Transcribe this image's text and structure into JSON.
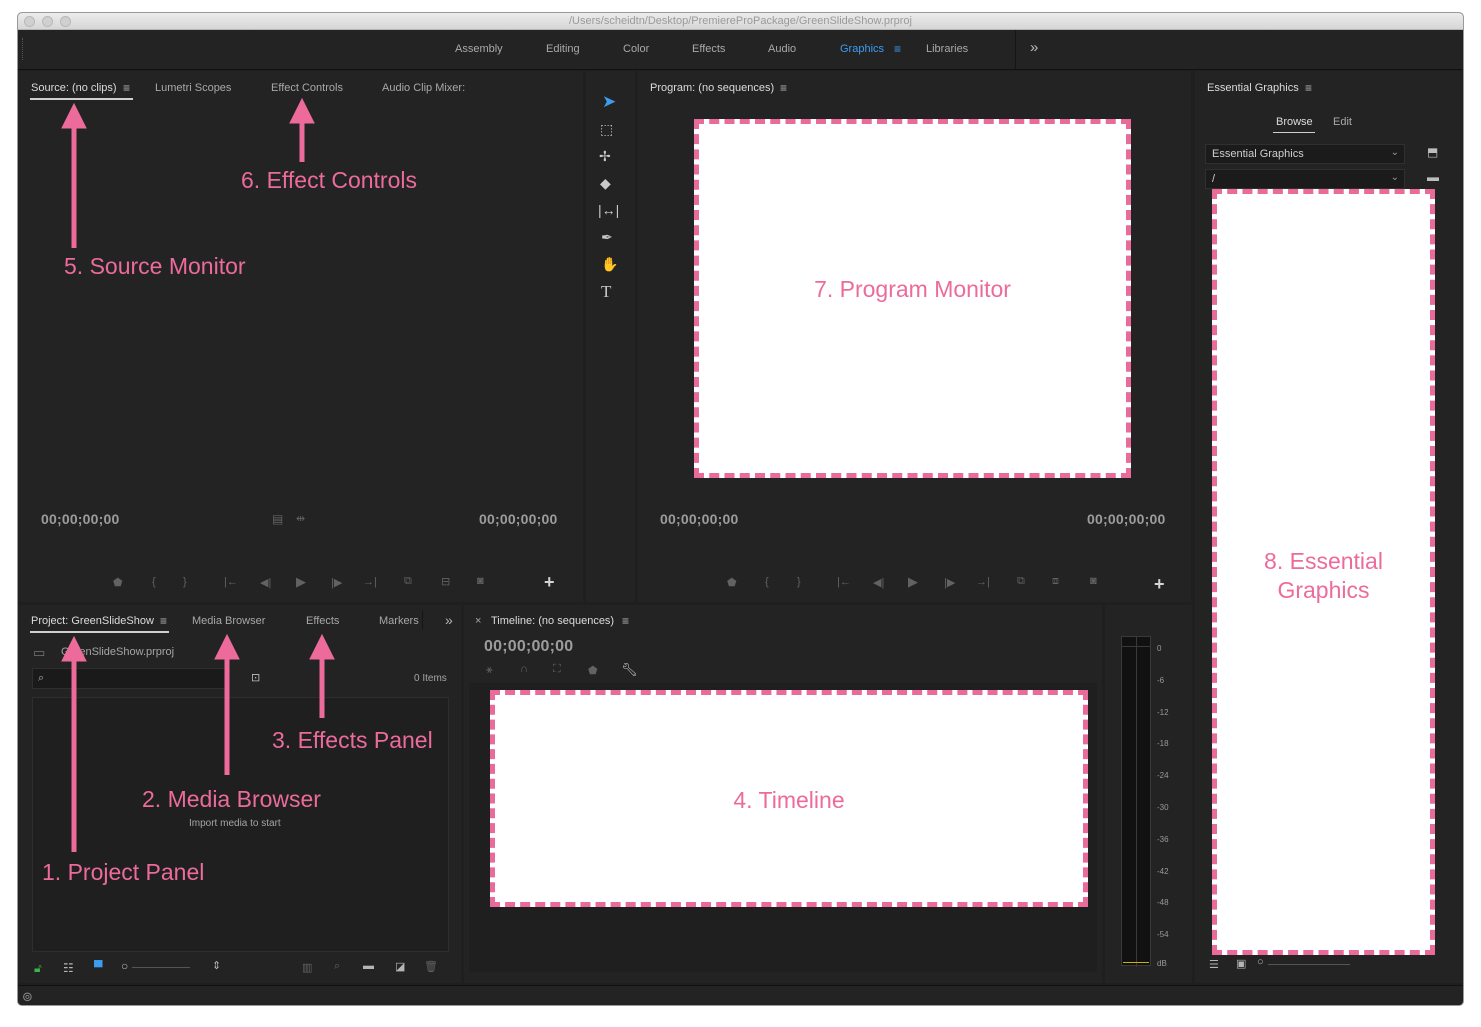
{
  "window": {
    "path": "/Users/scheidtn/Desktop/PremiereProPackage/GreenSlideShow.prproj"
  },
  "workspaces": {
    "tabs": [
      "Assembly",
      "Editing",
      "Color",
      "Effects",
      "Audio",
      "Graphics",
      "Libraries"
    ],
    "active": "Graphics",
    "menu_icon": "≡",
    "more_icon": "»"
  },
  "source_panel": {
    "tabs": [
      "Source: (no clips)",
      "Lumetri Scopes",
      "Effect Controls",
      "Audio Clip Mixer:"
    ],
    "menu_icon": "≡",
    "timecode_in": "00;00;00;00",
    "timecode_out": "00;00;00;00"
  },
  "program_panel": {
    "title": "Program: (no sequences)",
    "menu_icon": "≡",
    "timecode_in": "00;00;00;00",
    "timecode_out": "00;00;00;00"
  },
  "project_panel": {
    "tabs": [
      "Project: GreenSlideShow",
      "Media Browser",
      "Effects",
      "Markers"
    ],
    "menu_icon": "≡",
    "more_icon": "»",
    "filename": "GreenSlideShow.prproj",
    "items_count": "0 Items",
    "empty_hint": "Import media to start"
  },
  "timeline_panel": {
    "close_icon": "×",
    "title": "Timeline: (no sequences)",
    "menu_icon": "≡",
    "timecode": "00;00;00;00"
  },
  "audio_meter": {
    "labels": [
      "0",
      "-6",
      "-12",
      "-18",
      "-24",
      "-30",
      "-36",
      "-42",
      "-48",
      "-54",
      "dB"
    ]
  },
  "essential_graphics": {
    "title": "Essential Graphics",
    "menu_icon": "≡",
    "tabs": [
      "Browse",
      "Edit"
    ],
    "active_tab": "Browse",
    "dropdown_value": "Essential Graphics",
    "path_value": "/"
  },
  "annotations": {
    "source_monitor": "5. Source Monitor",
    "effect_controls": "6. Effect Controls",
    "program_monitor": "7. Program Monitor",
    "essential_graphics_line1": "8. Essential",
    "essential_graphics_line2": "Graphics",
    "project_panel": "1. Project Panel",
    "media_browser": "2. Media Browser",
    "effects_panel": "3. Effects Panel",
    "timeline": "4. Timeline",
    "accent_color": "#ec6b9b"
  }
}
